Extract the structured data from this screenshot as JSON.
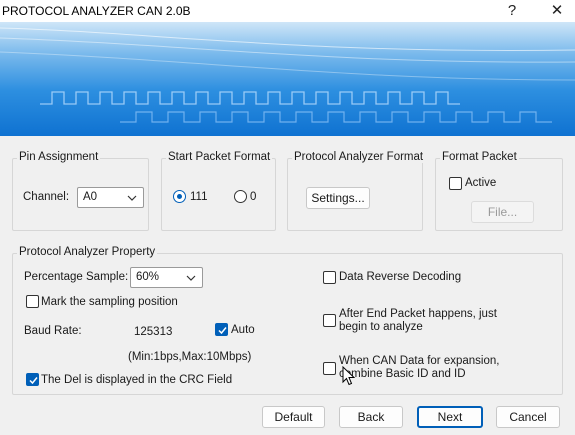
{
  "window": {
    "title": "PROTOCOL ANALYZER CAN 2.0B",
    "help_label": "?",
    "close_label": "✕"
  },
  "pin_assignment": {
    "title": "Pin Assignment",
    "channel_label": "Channel:",
    "channel_value": "A0"
  },
  "start_packet_format": {
    "title": "Start Packet Format",
    "options": [
      {
        "label": "111",
        "selected": true
      },
      {
        "label": "0",
        "selected": false
      }
    ]
  },
  "protocol_analyzer_format": {
    "title": "Protocol Analyzer Format",
    "settings_label": "Settings..."
  },
  "format_packet": {
    "title": "Format Packet",
    "active_label": "Active",
    "active_checked": false,
    "file_label": "File..."
  },
  "property": {
    "title": "Protocol Analyzer Property",
    "percentage_label": "Percentage Sample:",
    "percentage_value": "60%",
    "mark_sampling_label": "Mark the sampling position",
    "mark_sampling_checked": false,
    "baud_rate_label": "Baud Rate:",
    "baud_rate_value": "125313",
    "auto_label": "Auto",
    "auto_checked": true,
    "range_text": "(Min:1bps,Max:10Mbps)",
    "del_crc_label": "The Del is displayed in the CRC Field",
    "del_crc_checked": true,
    "reverse_label": "Data Reverse Decoding",
    "reverse_checked": false,
    "after_end_line1": "After End Packet happens, just",
    "after_end_line2": "begin to analyze",
    "after_end_checked": false,
    "expansion_line1": "When CAN Data for expansion,",
    "expansion_line2": "combine Basic ID and ID",
    "expansion_checked": false
  },
  "buttons": {
    "default": "Default",
    "back": "Back",
    "next": "Next",
    "cancel": "Cancel"
  },
  "colors": {
    "accent": "#005fb8",
    "banner_dark": "#0f72d1",
    "banner_light": "#cfe6f8"
  }
}
